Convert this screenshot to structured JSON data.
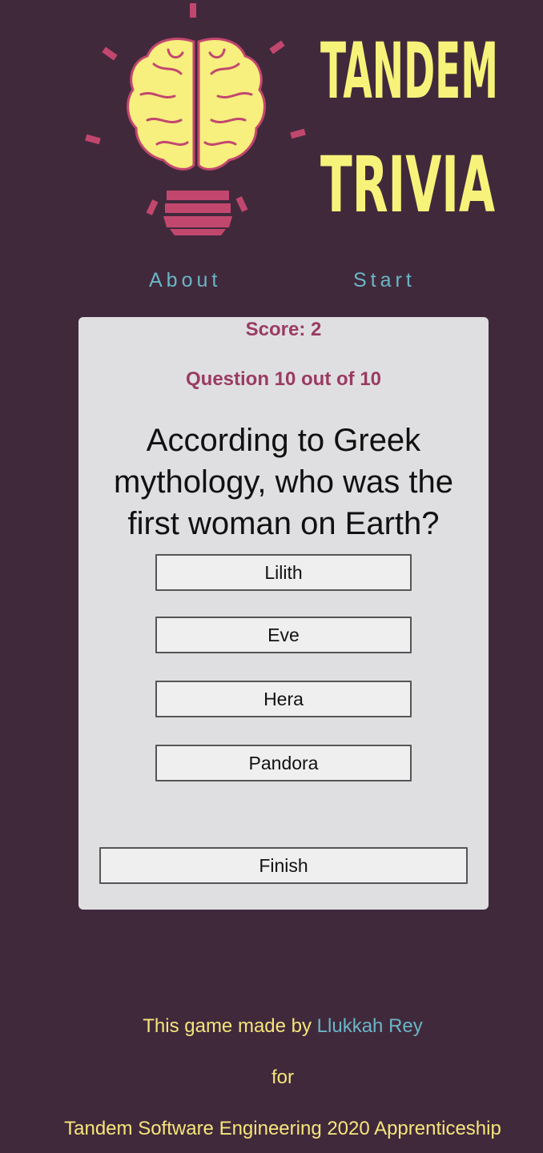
{
  "header": {
    "logo_icon": "brain-lightbulb-icon",
    "title_line1": "TANDEM",
    "title_line2": "TRIVIA"
  },
  "nav": {
    "about_label": "About",
    "start_label": "Start"
  },
  "quiz": {
    "score_label": "Score: 2",
    "question_counter": "Question 10 out of 10",
    "question": "According to Greek mythology, who was the first woman on Earth?",
    "answers": [
      {
        "label": "Lilith"
      },
      {
        "label": "Eve"
      },
      {
        "label": "Hera"
      },
      {
        "label": "Pandora"
      }
    ],
    "finish_label": "Finish"
  },
  "footer": {
    "made_by_prefix": "This game made by ",
    "author": "Llukkah Rey",
    "for_text": "for",
    "program": "Tandem Software Engineering 2020 Apprenticeship"
  },
  "colors": {
    "background": "#41293c",
    "card": "#dfdfe1",
    "accent_pink": "#9a3b62",
    "link_teal": "#6ab6c7",
    "title_yellow": "#f7f37a",
    "footer_yellow": "#f5e57a"
  }
}
